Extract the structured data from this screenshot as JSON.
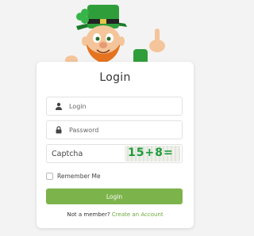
{
  "login": {
    "title": "Login",
    "username_placeholder": "Login",
    "password_placeholder": "Password",
    "captcha_placeholder": "Captcha",
    "captcha_text": "15+8=",
    "remember_label": "Remember Me",
    "submit_label": "Login",
    "signup_prompt": "Not a member?",
    "signup_link": "Create an Account"
  },
  "icons": {
    "username": "user-icon",
    "password": "lock-icon",
    "mascot": "leprechaun-mascot"
  },
  "colors": {
    "accent": "#7cb34b",
    "link": "#6aa83c",
    "captcha_text": "#1f9a3a"
  }
}
